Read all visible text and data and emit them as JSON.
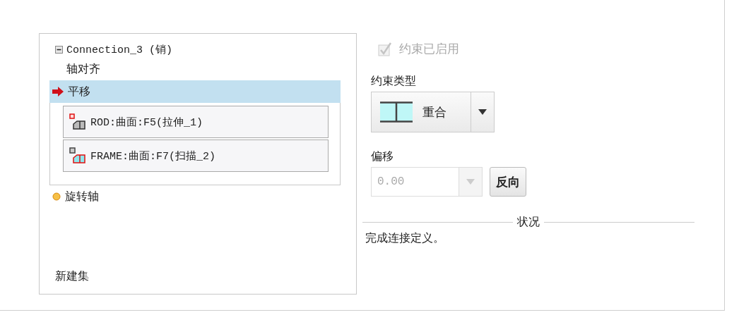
{
  "tree": {
    "root": {
      "label": "Connection_3 (销)",
      "expanded": true
    },
    "items": [
      {
        "label": "轴对齐",
        "kind": "plain",
        "selected": false
      },
      {
        "label": "平移",
        "kind": "current",
        "selected": true,
        "references": [
          {
            "label": "ROD:曲面:F5(拉伸_1)",
            "kind": "rod"
          },
          {
            "label": "FRAME:曲面:F7(扫描_2)",
            "kind": "frame"
          }
        ]
      },
      {
        "label": "旋转轴",
        "kind": "pending",
        "selected": false
      }
    ],
    "new_set": "新建集"
  },
  "enabled_checkbox": {
    "label": "约束已启用",
    "checked": true,
    "disabled": true
  },
  "constraint_type": {
    "label": "约束类型",
    "value": "重合"
  },
  "offset": {
    "label": "偏移",
    "value": "0.00",
    "disabled": true,
    "flip_button": "反向"
  },
  "status": {
    "title": "状况",
    "message": "完成连接定义。"
  }
}
